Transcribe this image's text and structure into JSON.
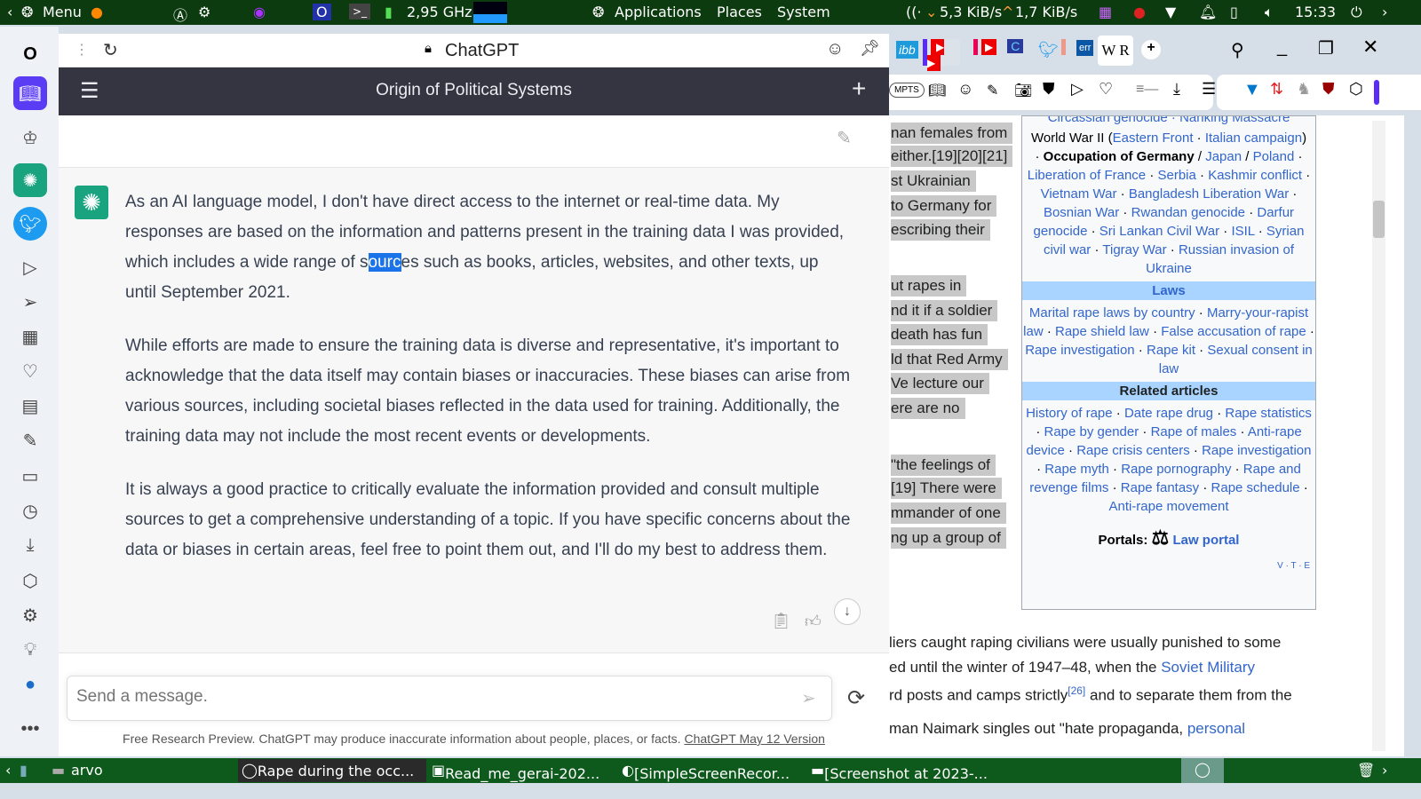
{
  "topbar": {
    "menu": "Menu",
    "cpu": "2,95 GHz",
    "applications": "Applications",
    "places": "Places",
    "system": "System",
    "down": "5,3 KiB/s",
    "up": "1,7 KiB/s",
    "clock": "15:33"
  },
  "chat": {
    "window_title": "ChatGPT",
    "conversation_title": "Origin of Political Systems",
    "paragraphs": [
      {
        "before": "As an AI language model, I don't have direct access to the internet or real-time data. My responses are based on the information and patterns present in the training data I was provided, which includes a wide range of s",
        "highlight": "ourc",
        "after": "es such as books, articles, websites, and other texts, up until September 2021."
      },
      {
        "text": "While efforts are made to ensure the training data is diverse and representative, it's important to acknowledge that the data itself may contain biases or inaccuracies. These biases can arise from various sources, including societal biases reflected in the data used for training. Additionally, the training data may not include the most recent events or developments."
      },
      {
        "text": "It is always a good practice to critically evaluate the information provided and consult multiple sources to get a comprehensive understanding of a topic. If you have specific concerns about the data or biases in certain areas, feel free to point them out, and I'll do my best to address them."
      }
    ],
    "input_placeholder": "Send a message.",
    "footer_text": "Free Research Preview. ChatGPT may produce inaccurate information about people, places, or facts.",
    "footer_link": "ChatGPT May 12 Version"
  },
  "browser": {
    "extension_badge": "MPTS",
    "tab_w": "W R"
  },
  "wiki": {
    "left_lines": [
      "nan females from",
      "either.[19][20][21]",
      "st Ukrainian",
      "to Germany for",
      "escribing their",
      "ut rapes in",
      "nd it if a soldier",
      "death has fun",
      "ld that Red Army",
      "Ve lecture our",
      "ere are no",
      "\"the feelings of",
      "[19] There were",
      "mmander of one",
      "ng up a group of"
    ],
    "top_cut": "Circassian genocide · Nanking Massacre",
    "wars": [
      "World War II (",
      "Eastern Front",
      " · ",
      "Italian campaign",
      ")"
    ],
    "occupation": "Occupation of Germany",
    "occ_links": [
      "Japan",
      "Poland"
    ],
    "war_links": [
      "Liberation of France",
      "Serbia",
      "Kashmir conflict",
      "Vietnam War",
      "Bangladesh Liberation War",
      "Bosnian War",
      "Rwandan genocide",
      "Darfur genocide",
      "Sri Lankan Civil War",
      "ISIL",
      "Syrian civil war",
      "Tigray War",
      "Russian invasion of Ukraine"
    ],
    "laws_header": "Laws",
    "laws": [
      "Marital rape laws by country",
      "Marry-your-rapist law",
      "Rape shield law",
      "False accusation of rape",
      "Rape investigation",
      "Rape kit",
      "Sexual consent in law"
    ],
    "related_header": "Related articles",
    "related": [
      "History of rape",
      "Date rape drug",
      "Rape statistics",
      "Rape by gender",
      "Rape of males",
      "Anti-rape device",
      "Rape crisis centers",
      "Rape investigation",
      "Rape myth",
      "Rape pornography",
      "Rape and revenge films",
      "Rape fantasy",
      "Rape schedule",
      "Anti-rape movement"
    ],
    "portals_label": "Portals:",
    "portal_link": "Law portal",
    "vte": "V · T · E",
    "body_lines": [
      "liers caught raping civilians were usually punished to some",
      "ed until the winter of 1947–48, when the ",
      "Soviet Military",
      "rd posts and camps strictly",
      "[26]",
      " and to separate them from the",
      "man Naimark singles out \"hate propaganda, ",
      "personal"
    ]
  },
  "taskbar": {
    "items": [
      "arvo",
      "Rape during the occ...",
      "Read_me_gerai-202...",
      "[SimpleScreenRecor...",
      "[Screenshot at 2023-..."
    ]
  }
}
